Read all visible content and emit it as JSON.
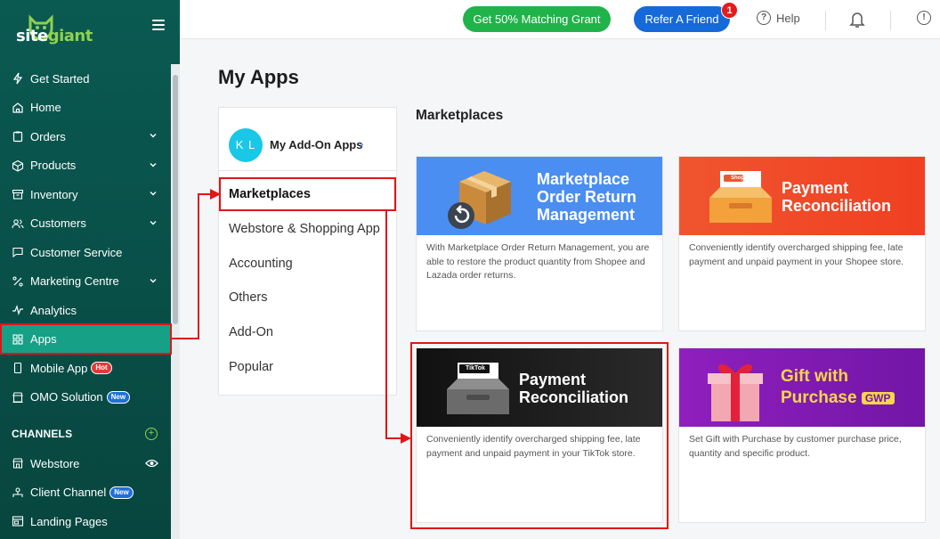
{
  "brand": {
    "name_a": "site",
    "name_b": "giant",
    "accent": "#8fd14f",
    "sidebar_bg": "#0a5a52"
  },
  "sidebar": {
    "items": [
      {
        "label": "Get Started",
        "icon": "sparkle-icon",
        "chevron": false
      },
      {
        "label": "Home",
        "icon": "home-icon",
        "chevron": false
      },
      {
        "label": "Orders",
        "icon": "clipboard-icon",
        "chevron": true
      },
      {
        "label": "Products",
        "icon": "box-icon",
        "chevron": true
      },
      {
        "label": "Inventory",
        "icon": "inventory-icon",
        "chevron": true
      },
      {
        "label": "Customers",
        "icon": "users-icon",
        "chevron": true
      },
      {
        "label": "Customer Service",
        "icon": "chat-icon",
        "chevron": false
      },
      {
        "label": "Marketing Centre",
        "icon": "percent-icon",
        "chevron": true
      },
      {
        "label": "Analytics",
        "icon": "pulse-icon",
        "chevron": false
      },
      {
        "label": "Apps",
        "icon": "grid-icon",
        "chevron": false,
        "active": true
      },
      {
        "label": "Mobile App",
        "icon": "mobile-icon",
        "badge": "Hot"
      },
      {
        "label": "OMO Solution",
        "icon": "store-icon",
        "badge": "New"
      }
    ],
    "channels_title": "CHANNELS",
    "channels": [
      {
        "label": "Webstore",
        "icon": "webstore-icon"
      },
      {
        "label": "Client Channel",
        "icon": "client-icon",
        "badge": "New"
      },
      {
        "label": "Landing Pages",
        "icon": "landing-icon"
      }
    ]
  },
  "topbar": {
    "grant_label": "Get 50% Matching Grant",
    "refer_label": "Refer A Friend",
    "refer_count": "1",
    "help_label": "Help",
    "grant_color": "#20b34a",
    "refer_color": "#1669d8"
  },
  "page": {
    "title": "My Apps",
    "addon": {
      "initials": "K L",
      "label": "My Add-On Apps"
    },
    "categories": [
      "Marketplaces",
      "Webstore & Shopping App",
      "Accounting",
      "Others",
      "Add-On",
      "Popular"
    ],
    "section_title": "Marketplaces",
    "cards": [
      {
        "title_lines": [
          "Marketplace",
          "Order Return",
          "Management"
        ],
        "desc": "With Marketplace Order Return Management, you are able to restore the product quantity from Shopee and Lazada order returns."
      },
      {
        "title_lines": [
          "Payment",
          "Reconciliation"
        ],
        "tag": "Shopee",
        "desc": "Conveniently identify overcharged shipping fee, late payment and unpaid payment in your Shopee store."
      },
      {
        "title_lines": [
          "Payment",
          "Reconciliation"
        ],
        "tag": "TikTok",
        "desc": "Conveniently identify overcharged shipping fee, late payment and unpaid payment in your TikTok store."
      },
      {
        "title_lines": [
          "Gift with",
          "Purchase"
        ],
        "tag": "GWP",
        "desc": "Set Gift with Purchase by customer purchase price, quantity and specific product."
      }
    ]
  }
}
